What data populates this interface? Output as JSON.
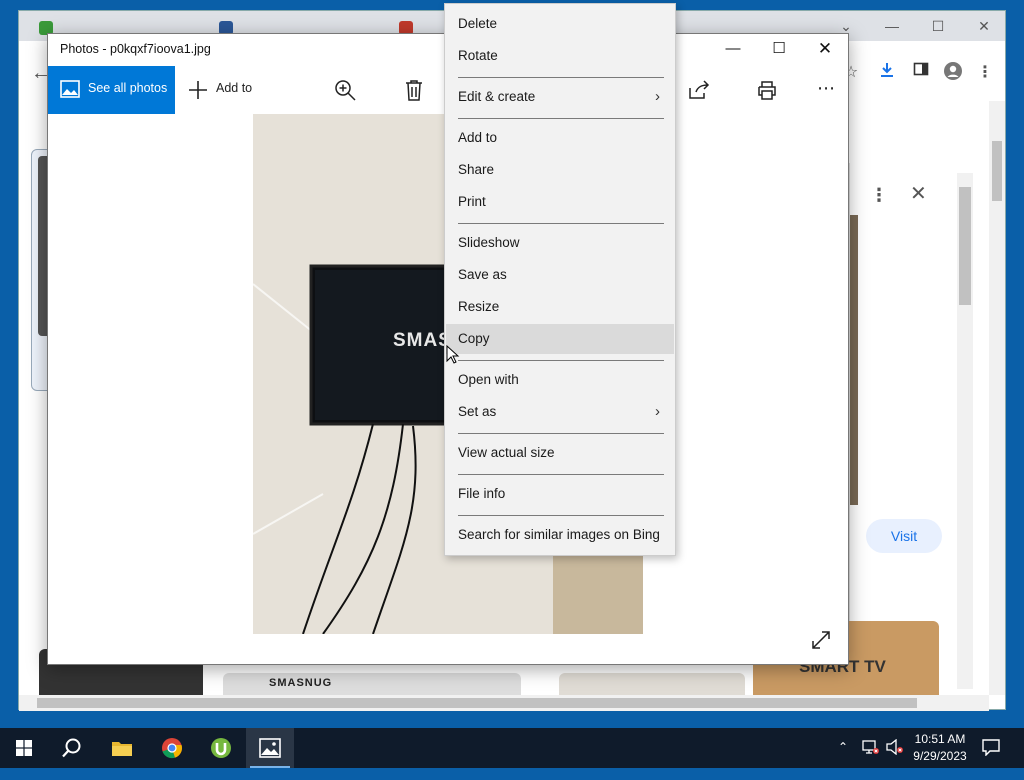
{
  "browser": {
    "visit_label": "Visit",
    "thumbs": [
      {
        "label": "SMASNUG"
      },
      {
        "label": "SMART TV"
      }
    ]
  },
  "photos": {
    "title": "Photos - p0kqxf7ioova1.jpg",
    "see_all_label": "See all photos",
    "add_to_label": "Add to",
    "photo_text": "SMAS"
  },
  "context_menu": {
    "items": [
      {
        "label": "Delete"
      },
      {
        "label": "Rotate"
      },
      {
        "label": "Edit & create",
        "submenu": true
      },
      {
        "label": "Add to"
      },
      {
        "label": "Share"
      },
      {
        "label": "Print"
      },
      {
        "label": "Slideshow"
      },
      {
        "label": "Save as"
      },
      {
        "label": "Resize"
      },
      {
        "label": "Copy",
        "highlighted": true
      },
      {
        "label": "Open with"
      },
      {
        "label": "Set as",
        "submenu": true
      },
      {
        "label": "View actual size"
      },
      {
        "label": "File info"
      },
      {
        "label": "Search for similar images on Bing"
      }
    ]
  },
  "taskbar": {
    "time": "10:51 AM",
    "date": "9/29/2023",
    "apps": [
      "start-icon",
      "search-icon",
      "file-explorer-icon",
      "chrome-icon",
      "utorrent-icon",
      "photos-icon"
    ]
  },
  "colors": {
    "accent": "#0078d7",
    "taskbar": "#0f1b2b",
    "desktop": "#0a5fa8"
  }
}
